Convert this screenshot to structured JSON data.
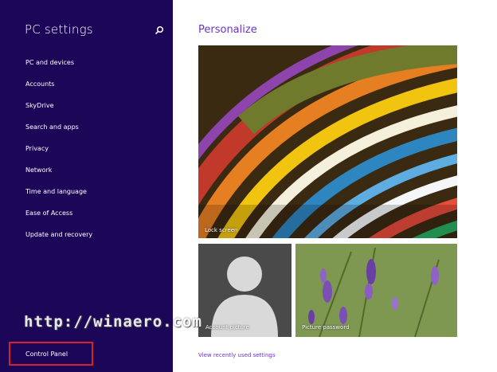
{
  "sidebar": {
    "title": "PC settings",
    "search_icon": "search-icon",
    "items": [
      {
        "label": "PC and devices"
      },
      {
        "label": "Accounts"
      },
      {
        "label": "SkyDrive"
      },
      {
        "label": "Search and apps"
      },
      {
        "label": "Privacy"
      },
      {
        "label": "Network"
      },
      {
        "label": "Time and language"
      },
      {
        "label": "Ease of Access"
      },
      {
        "label": "Update and recovery"
      }
    ],
    "control_panel": "Control Panel",
    "background_color": "#1b0657"
  },
  "watermark": "http://winaero.com",
  "main": {
    "title": "Personalize",
    "title_color": "#6b35c8",
    "tiles": {
      "lock_screen": "Lock screen",
      "account_picture": "Account picture",
      "picture_password": "Picture password"
    },
    "recent_link": "View recently used settings"
  },
  "highlight_color": "#d9202e"
}
